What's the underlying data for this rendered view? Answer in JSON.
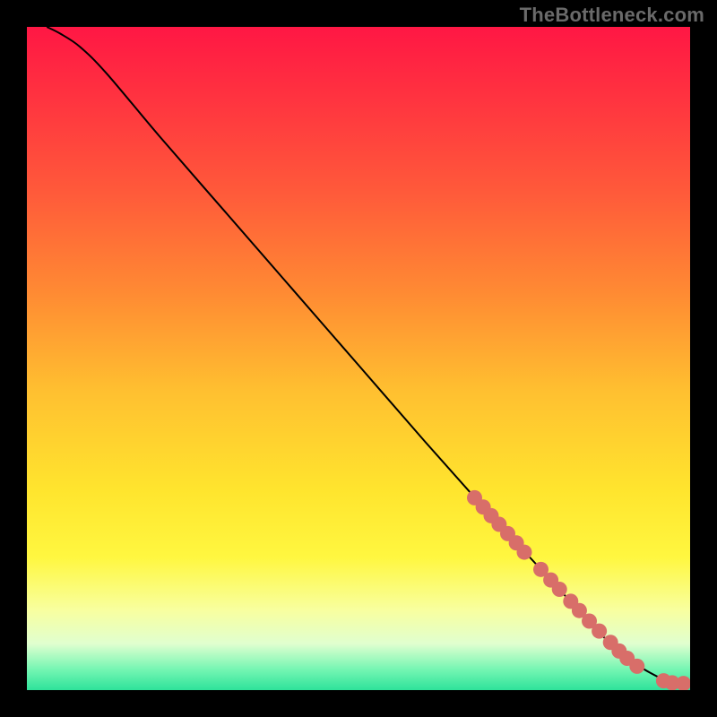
{
  "watermark": "TheBottleneck.com",
  "colors": {
    "dot": "#d86e69",
    "curve": "#000000",
    "bg_black": "#000000",
    "gradient_stops": [
      {
        "offset": 0.0,
        "color": "#ff1744"
      },
      {
        "offset": 0.1,
        "color": "#ff3140"
      },
      {
        "offset": 0.25,
        "color": "#ff5a3a"
      },
      {
        "offset": 0.4,
        "color": "#ff8a33"
      },
      {
        "offset": 0.55,
        "color": "#ffc030"
      },
      {
        "offset": 0.7,
        "color": "#ffe52e"
      },
      {
        "offset": 0.8,
        "color": "#fff740"
      },
      {
        "offset": 0.88,
        "color": "#f8ffa0"
      },
      {
        "offset": 0.93,
        "color": "#e0ffcf"
      },
      {
        "offset": 0.97,
        "color": "#72f5b2"
      },
      {
        "offset": 1.0,
        "color": "#2ee29a"
      }
    ]
  },
  "chart_data": {
    "type": "line",
    "title": "",
    "xlabel": "",
    "ylabel": "",
    "xlim": [
      0,
      100
    ],
    "ylim": [
      0,
      100
    ],
    "series": [
      {
        "name": "curve",
        "x": [
          3,
          5,
          8,
          12,
          20,
          30,
          40,
          50,
          60,
          68,
          74,
          80,
          85,
          88,
          90,
          92,
          94,
          96,
          97.5,
          99
        ],
        "y": [
          100,
          99,
          97,
          93,
          83.5,
          72,
          60.5,
          49,
          37.5,
          28.5,
          22,
          15.5,
          10,
          7,
          5.3,
          3.8,
          2.6,
          1.6,
          1.1,
          1.0
        ]
      }
    ],
    "points": [
      {
        "x": 67.5,
        "y": 29.0
      },
      {
        "x": 68.8,
        "y": 27.6
      },
      {
        "x": 70.0,
        "y": 26.3
      },
      {
        "x": 71.2,
        "y": 25.0
      },
      {
        "x": 72.5,
        "y": 23.6
      },
      {
        "x": 73.8,
        "y": 22.2
      },
      {
        "x": 75.0,
        "y": 20.8
      },
      {
        "x": 77.5,
        "y": 18.2
      },
      {
        "x": 79.0,
        "y": 16.6
      },
      {
        "x": 80.3,
        "y": 15.2
      },
      {
        "x": 82.0,
        "y": 13.4
      },
      {
        "x": 83.3,
        "y": 12.0
      },
      {
        "x": 84.8,
        "y": 10.4
      },
      {
        "x": 86.3,
        "y": 8.9
      },
      {
        "x": 88.0,
        "y": 7.2
      },
      {
        "x": 89.3,
        "y": 5.9
      },
      {
        "x": 90.5,
        "y": 4.8
      },
      {
        "x": 92.0,
        "y": 3.6
      },
      {
        "x": 96.0,
        "y": 1.4
      },
      {
        "x": 97.3,
        "y": 1.1
      },
      {
        "x": 99.0,
        "y": 1.0
      }
    ]
  }
}
